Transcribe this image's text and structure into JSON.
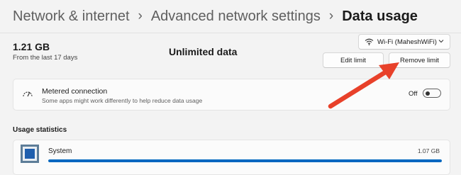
{
  "breadcrumb": {
    "items": [
      "Network & internet",
      "Advanced network settings",
      "Data usage"
    ],
    "separator": "›"
  },
  "summary": {
    "total": "1.21 GB",
    "period": "From the last 17 days",
    "limit_status": "Unlimited data"
  },
  "network_select": {
    "value": "Wi-Fi (MaheshWiFi)",
    "icon": "wifi-icon"
  },
  "buttons": {
    "edit_limit": "Edit limit",
    "remove_limit": "Remove limit"
  },
  "metered": {
    "title": "Metered connection",
    "description": "Some apps might work differently to help reduce data usage",
    "state_label": "Off",
    "enabled": false,
    "icon": "speedometer-icon"
  },
  "usage_statistics": {
    "heading": "Usage statistics",
    "apps": [
      {
        "name": "System",
        "usage": "1.07 GB",
        "fraction": 1.0,
        "icon": "system-app-icon"
      }
    ]
  },
  "colors": {
    "accent": "#0067c0",
    "annotation_arrow": "#e8412a"
  }
}
